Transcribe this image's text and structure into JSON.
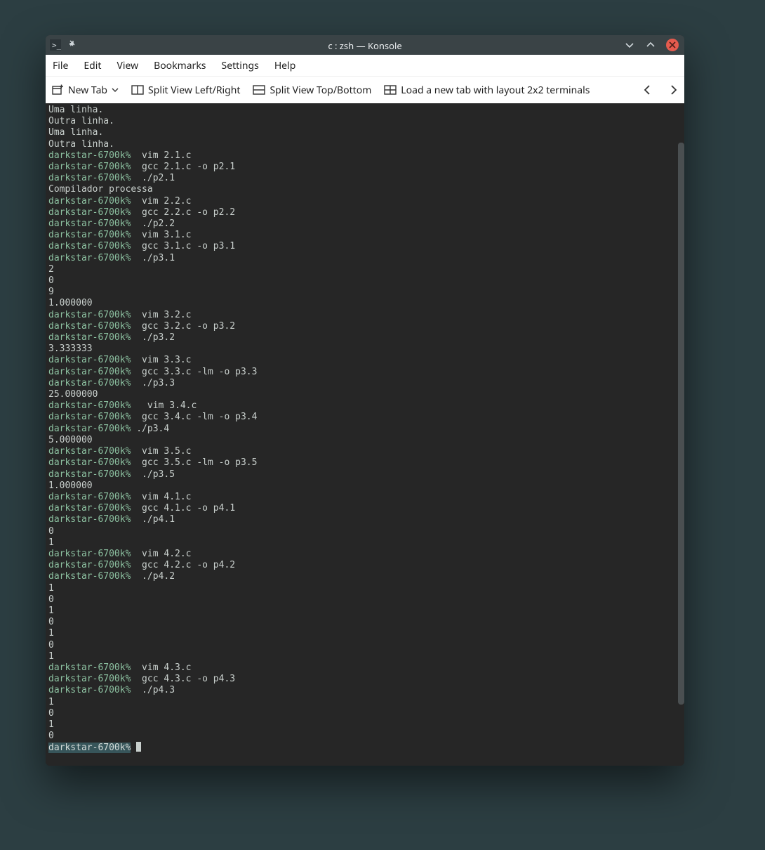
{
  "window_title": "c : zsh — Konsole",
  "menu": [
    "File",
    "Edit",
    "View",
    "Bookmarks",
    "Settings",
    "Help"
  ],
  "toolbar": {
    "new_tab": "New Tab",
    "split_lr": "Split View Left/Right",
    "split_tb": "Split View Top/Bottom",
    "load_layout": "Load a new tab with layout 2x2 terminals"
  },
  "prompt_text": "darkstar-6700k%",
  "lines": [
    {
      "t": "out",
      "text": "Uma linha."
    },
    {
      "t": "out",
      "text": "Outra linha."
    },
    {
      "t": "out",
      "text": "Uma linha."
    },
    {
      "t": "out",
      "text": "Outra linha."
    },
    {
      "t": "cmd",
      "text": "  vim 2.1.c"
    },
    {
      "t": "cmd",
      "text": "  gcc 2.1.c -o p2.1"
    },
    {
      "t": "cmd",
      "text": "  ./p2.1"
    },
    {
      "t": "out",
      "text": "Compilador processa"
    },
    {
      "t": "cmd",
      "text": "  vim 2.2.c"
    },
    {
      "t": "cmd",
      "text": "  gcc 2.2.c -o p2.2"
    },
    {
      "t": "cmd",
      "text": "  ./p2.2"
    },
    {
      "t": "cmd",
      "text": "  vim 3.1.c"
    },
    {
      "t": "cmd",
      "text": "  gcc 3.1.c -o p3.1"
    },
    {
      "t": "cmd",
      "text": "  ./p3.1"
    },
    {
      "t": "out",
      "text": "2"
    },
    {
      "t": "out",
      "text": "0"
    },
    {
      "t": "out",
      "text": "9"
    },
    {
      "t": "out",
      "text": "1.000000"
    },
    {
      "t": "cmd",
      "text": "  vim 3.2.c"
    },
    {
      "t": "cmd",
      "text": "  gcc 3.2.c -o p3.2"
    },
    {
      "t": "cmd",
      "text": "  ./p3.2"
    },
    {
      "t": "out",
      "text": "3.333333"
    },
    {
      "t": "cmd",
      "text": "  vim 3.3.c"
    },
    {
      "t": "cmd",
      "text": "  gcc 3.3.c -lm -o p3.3"
    },
    {
      "t": "cmd",
      "text": "  ./p3.3"
    },
    {
      "t": "out",
      "text": "25.000000"
    },
    {
      "t": "cmd",
      "text": "   vim 3.4.c"
    },
    {
      "t": "cmd",
      "text": "  gcc 3.4.c -lm -o p3.4"
    },
    {
      "t": "cmd",
      "text": " ./p3.4"
    },
    {
      "t": "out",
      "text": "5.000000"
    },
    {
      "t": "cmd",
      "text": "  vim 3.5.c"
    },
    {
      "t": "cmd",
      "text": "  gcc 3.5.c -lm -o p3.5"
    },
    {
      "t": "cmd",
      "text": "  ./p3.5"
    },
    {
      "t": "out",
      "text": "1.000000"
    },
    {
      "t": "cmd",
      "text": "  vim 4.1.c"
    },
    {
      "t": "cmd",
      "text": "  gcc 4.1.c -o p4.1"
    },
    {
      "t": "cmd",
      "text": "  ./p4.1"
    },
    {
      "t": "out",
      "text": "0"
    },
    {
      "t": "out",
      "text": "1"
    },
    {
      "t": "cmd",
      "text": "  vim 4.2.c"
    },
    {
      "t": "cmd",
      "text": "  gcc 4.2.c -o p4.2"
    },
    {
      "t": "cmd",
      "text": "  ./p4.2"
    },
    {
      "t": "out",
      "text": "1"
    },
    {
      "t": "out",
      "text": "0"
    },
    {
      "t": "out",
      "text": "1"
    },
    {
      "t": "out",
      "text": "0"
    },
    {
      "t": "out",
      "text": "1"
    },
    {
      "t": "out",
      "text": "0"
    },
    {
      "t": "out",
      "text": "1"
    },
    {
      "t": "cmd",
      "text": "  vim 4.3.c"
    },
    {
      "t": "cmd",
      "text": "  gcc 4.3.c -o p4.3"
    },
    {
      "t": "cmd",
      "text": "  ./p4.3"
    },
    {
      "t": "out",
      "text": "1"
    },
    {
      "t": "out",
      "text": "0"
    },
    {
      "t": "out",
      "text": "1"
    },
    {
      "t": "out",
      "text": "0"
    }
  ]
}
